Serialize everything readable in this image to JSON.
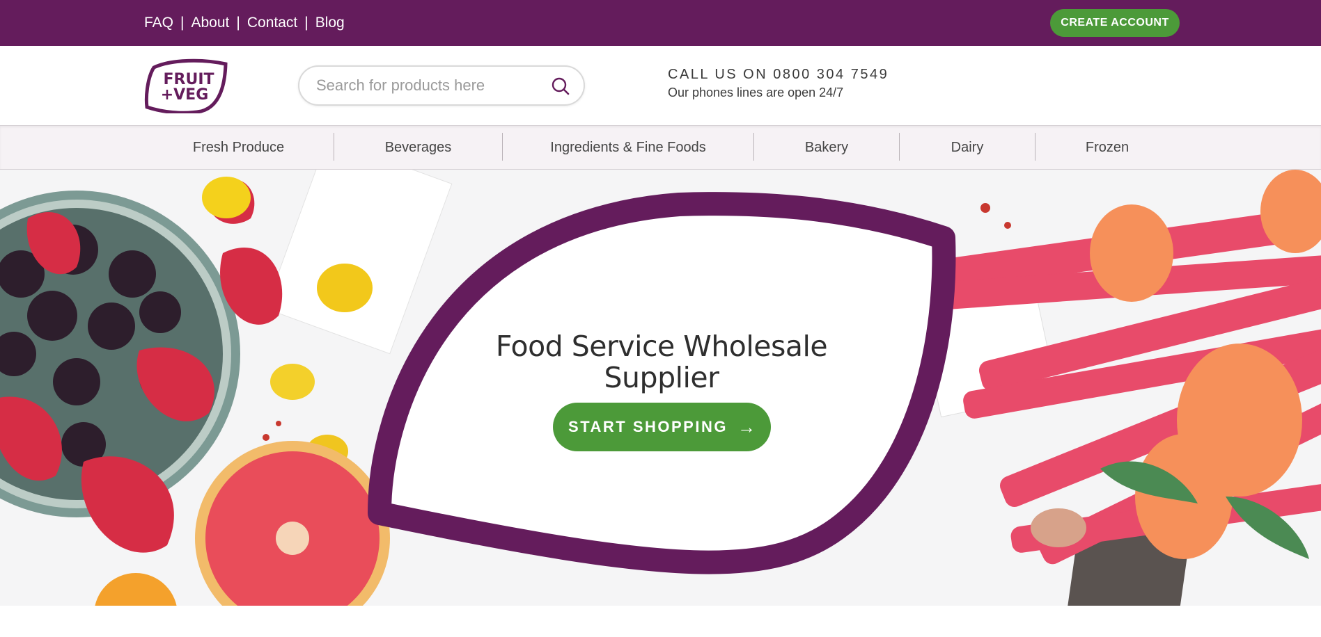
{
  "topbar": {
    "links": [
      "FAQ",
      "About",
      "Contact",
      "Blog"
    ],
    "create_account": "CREATE ACCOUNT"
  },
  "header": {
    "logo": {
      "line1": "FRUIT",
      "line2": "+VEG"
    },
    "search": {
      "placeholder": "Search for products here",
      "icon": "search-icon"
    },
    "call": {
      "line1": "CALL US ON 0800 304 7549",
      "line2": "Our phones lines are open 24/7"
    }
  },
  "categories": [
    "Fresh Produce",
    "Beverages",
    "Ingredients & Fine Foods",
    "Bakery",
    "Dairy",
    "Frozen"
  ],
  "hero": {
    "title_line1": "Food Service Wholesale",
    "title_line2": "Supplier",
    "cta": "START SHOPPING",
    "cta_icon": "arrow-right-icon"
  },
  "colors": {
    "brand_purple": "#641c5c",
    "brand_green": "#4c9a39",
    "nav_bg": "#f6f2f5"
  }
}
